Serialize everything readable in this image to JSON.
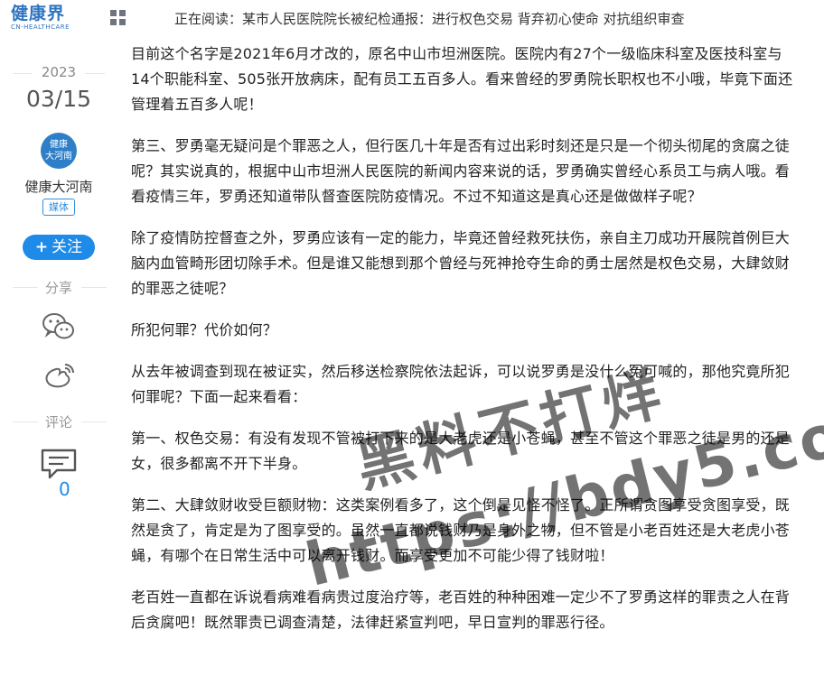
{
  "header": {
    "logo_main": "健康界",
    "logo_sub": "CN-HEALTHCARE",
    "reading_prefix": "正在阅读：",
    "reading_title": "某市人民医院院长被纪检通报：进行权色交易 背弃初心使命 对抗组织审查"
  },
  "sidebar": {
    "year": "2023",
    "month_day": "03/15",
    "avatar_text_1": "健康",
    "avatar_text_2": "大河南",
    "author": "健康大河南",
    "media_tag": "媒体",
    "follow_plus": "+",
    "follow_label": "关注",
    "share_label": "分享",
    "comment_label": "评论",
    "comment_count": "0"
  },
  "article": {
    "paragraphs": [
      "目前这个名字是2021年6月才改的，原名中山市坦洲医院。医院内有27个一级临床科室及医技科室与14个职能科室、505张开放病床，配有员工五百多人。看来曾经的罗勇院长职权也不小哦，毕竟下面还管理着五百多人呢！",
      "第三、罗勇毫无疑问是个罪恶之人，但行医几十年是否有过出彩时刻还是只是一个彻头彻尾的贪腐之徒呢？其实说真的，根据中山市坦洲人民医院的新闻内容来说的话，罗勇确实曾经心系员工与病人哦。看看疫情三年，罗勇还知道带队督查医院防疫情况。不过不知道这是真心还是做做样子呢？",
      "除了疫情防控督查之外，罗勇应该有一定的能力，毕竟还曾经救死扶伤，亲自主刀成功开展院首例巨大脑内血管畸形团切除手术。但是谁又能想到那个曾经与死神抢夺生命的勇士居然是权色交易，大肆敛财的罪恶之徒呢？",
      "所犯何罪？代价如何？",
      "从去年被调查到现在被证实，然后移送检察院依法起诉，可以说罗勇是没什么冤可喊的，那他究竟所犯何罪呢？下面一起来看看：",
      "第一、权色交易：有没有发现不管被打下来的是大老虎还是小苍蝇，甚至不管这个罪恶之徒是男的还是女，很多都离不开下半身。",
      "第二、大肆敛财收受巨额财物：这类案例看多了，这个倒是见怪不怪了。正所谓贪图享受贪图享受，既然是贪了，肯定是为了图享受的。虽然一直都说钱财乃是身外之物，但不管是小老百姓还是大老虎小苍蝇，有哪个在日常生活中可以离开钱财。而享受更加不可能少得了钱财啦！",
      "老百姓一直都在诉说看病难看病贵过度治疗等，老百姓的种种困难一定少不了罗勇这样的罪责之人在背后贪腐吧！既然罪责已调查清楚，法律赶紧宣判吧，早日宣判的罪恶行径。"
    ]
  },
  "watermark": {
    "line1": "黑料不打烊",
    "line2": "https://bdy5.co"
  },
  "colors": {
    "brand_blue": "#2f74c0",
    "follow_blue": "#1e8be8"
  }
}
